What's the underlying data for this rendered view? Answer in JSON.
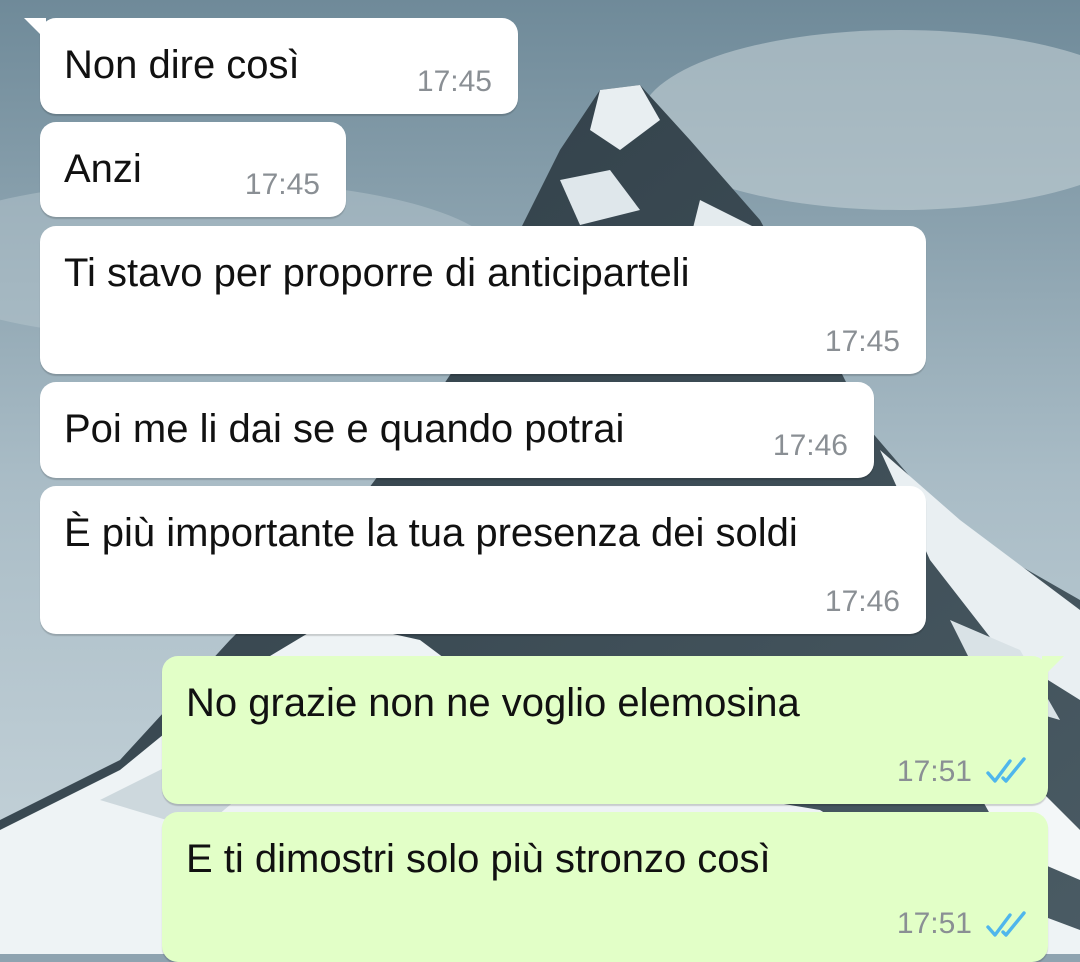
{
  "wallpaper": {
    "description_icon": "mountain-wallpaper"
  },
  "messages": [
    {
      "direction": "incoming",
      "text": "Non dire così",
      "time": "17:45"
    },
    {
      "direction": "incoming",
      "text": "Anzi",
      "time": "17:45"
    },
    {
      "direction": "incoming",
      "text": "Ti stavo per proporre di anticiparteli",
      "time": "17:45"
    },
    {
      "direction": "incoming",
      "text": "Poi me li dai se e quando potrai",
      "time": "17:46"
    },
    {
      "direction": "incoming",
      "text": "È più importante la tua presenza dei soldi",
      "time": "17:46"
    },
    {
      "direction": "outgoing",
      "text": "No grazie non ne voglio elemosina",
      "time": "17:51",
      "status_icon": "double-check-read-icon"
    },
    {
      "direction": "outgoing",
      "text": "E ti dimostri solo più stronzo così",
      "time": "17:51",
      "status_icon": "double-check-read-icon"
    }
  ],
  "colors": {
    "incoming_bubble": "#ffffff",
    "outgoing_bubble": "#e2ffc7",
    "read_ticks": "#4fb6ec",
    "timestamp": "#8a8f94"
  }
}
